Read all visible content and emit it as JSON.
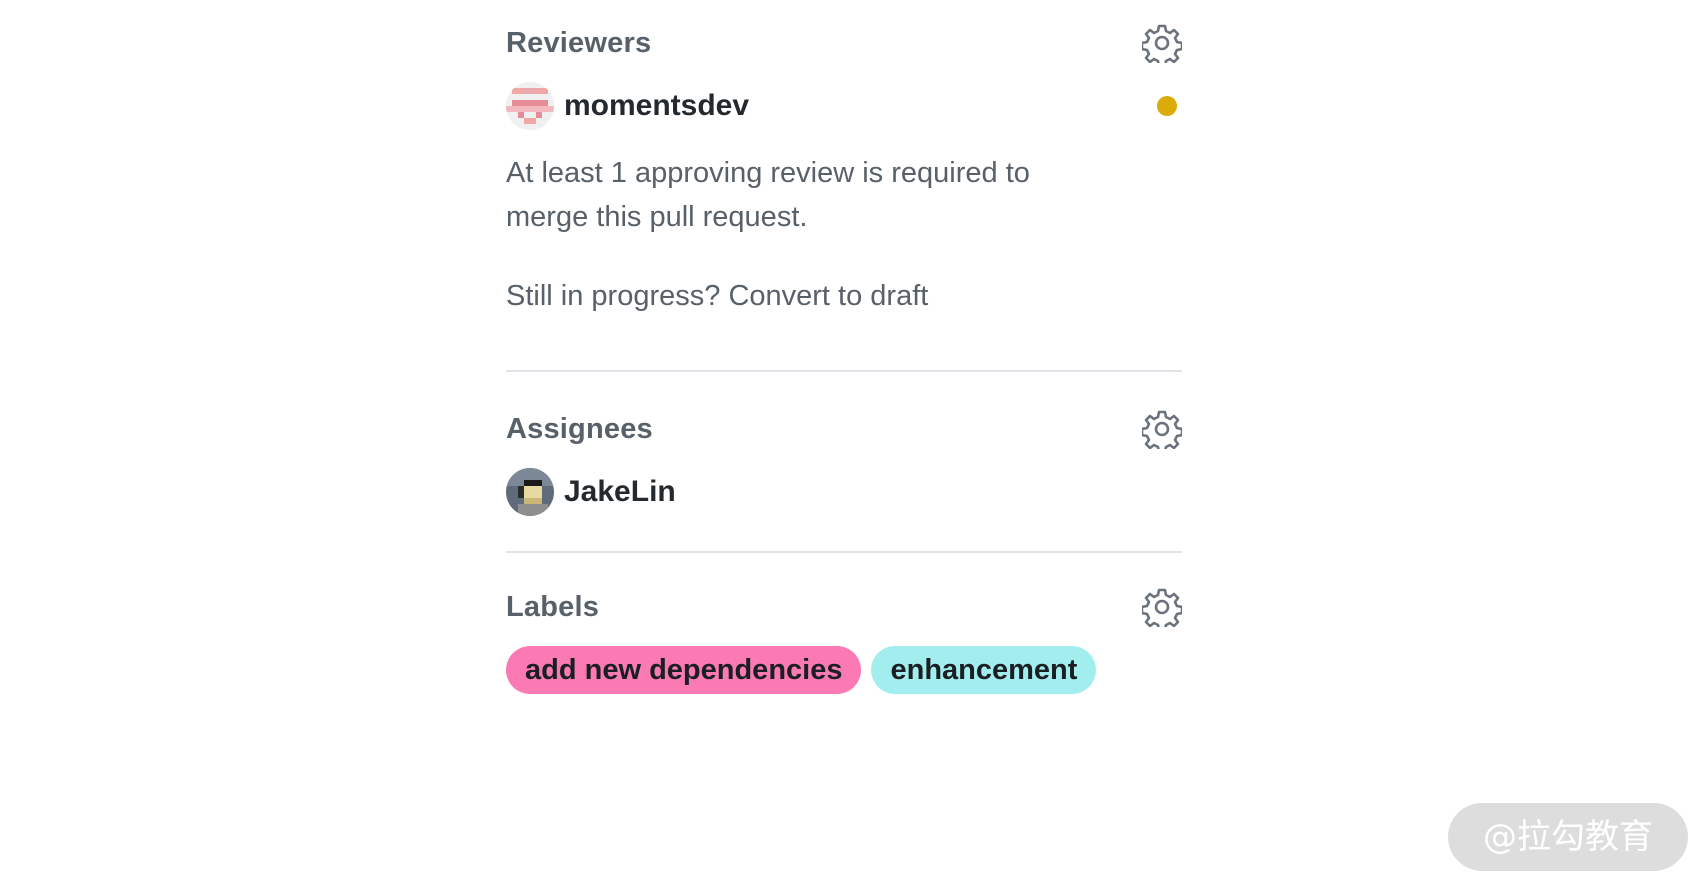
{
  "reviewers": {
    "title": "Reviewers",
    "settings_icon": "gear-icon",
    "user": {
      "name": "momentsdev",
      "status_color": "#dbab09"
    },
    "approval_text": "At least 1 approving review is required to merge this pull request.",
    "draft_prompt": "Still in progress? ",
    "draft_link": "Convert to draft"
  },
  "assignees": {
    "title": "Assignees",
    "settings_icon": "gear-icon",
    "user": {
      "name": "JakeLin"
    }
  },
  "labels": {
    "title": "Labels",
    "settings_icon": "gear-icon",
    "items": [
      {
        "name": "add new dependencies",
        "color": "#fc7ab3"
      },
      {
        "name": "enhancement",
        "color": "#a2eeef"
      }
    ]
  },
  "watermark": "@拉勾教育"
}
